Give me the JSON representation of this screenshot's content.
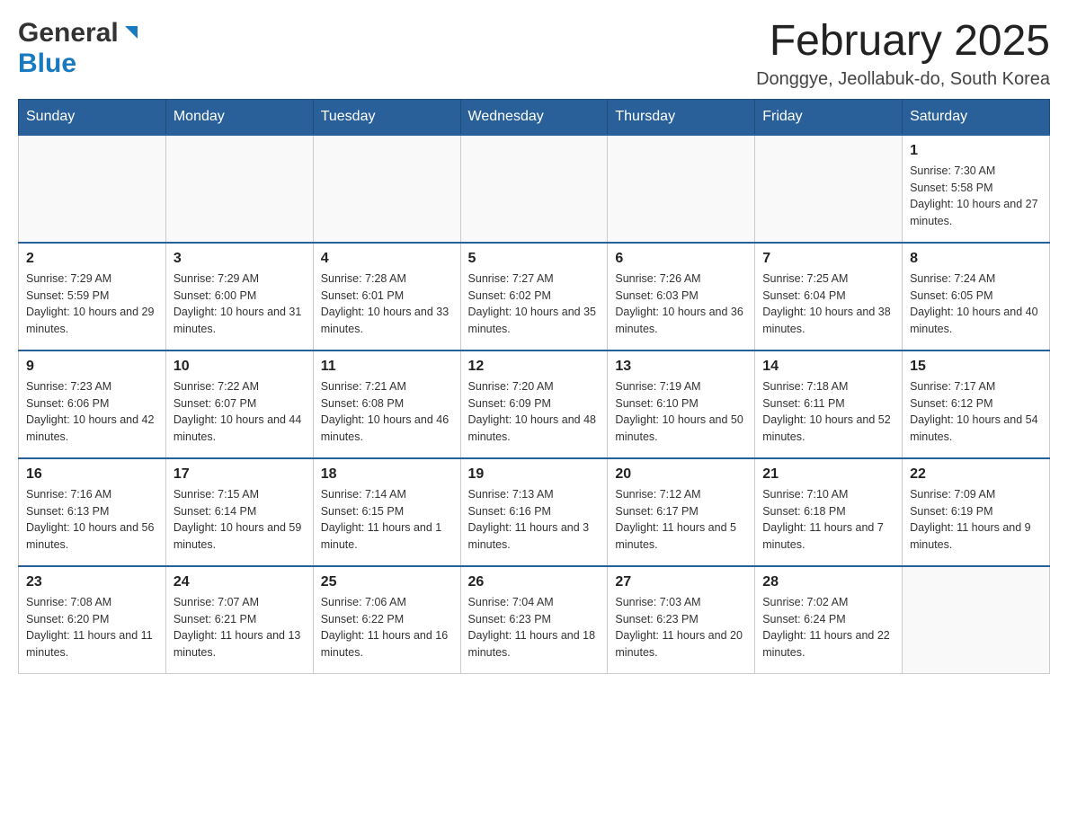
{
  "header": {
    "title": "February 2025",
    "location": "Donggye, Jeollabuk-do, South Korea",
    "logo_general": "General",
    "logo_blue": "Blue"
  },
  "days_of_week": [
    "Sunday",
    "Monday",
    "Tuesday",
    "Wednesday",
    "Thursday",
    "Friday",
    "Saturday"
  ],
  "weeks": [
    [
      {
        "day": "",
        "info": ""
      },
      {
        "day": "",
        "info": ""
      },
      {
        "day": "",
        "info": ""
      },
      {
        "day": "",
        "info": ""
      },
      {
        "day": "",
        "info": ""
      },
      {
        "day": "",
        "info": ""
      },
      {
        "day": "1",
        "info": "Sunrise: 7:30 AM\nSunset: 5:58 PM\nDaylight: 10 hours and 27 minutes."
      }
    ],
    [
      {
        "day": "2",
        "info": "Sunrise: 7:29 AM\nSunset: 5:59 PM\nDaylight: 10 hours and 29 minutes."
      },
      {
        "day": "3",
        "info": "Sunrise: 7:29 AM\nSunset: 6:00 PM\nDaylight: 10 hours and 31 minutes."
      },
      {
        "day": "4",
        "info": "Sunrise: 7:28 AM\nSunset: 6:01 PM\nDaylight: 10 hours and 33 minutes."
      },
      {
        "day": "5",
        "info": "Sunrise: 7:27 AM\nSunset: 6:02 PM\nDaylight: 10 hours and 35 minutes."
      },
      {
        "day": "6",
        "info": "Sunrise: 7:26 AM\nSunset: 6:03 PM\nDaylight: 10 hours and 36 minutes."
      },
      {
        "day": "7",
        "info": "Sunrise: 7:25 AM\nSunset: 6:04 PM\nDaylight: 10 hours and 38 minutes."
      },
      {
        "day": "8",
        "info": "Sunrise: 7:24 AM\nSunset: 6:05 PM\nDaylight: 10 hours and 40 minutes."
      }
    ],
    [
      {
        "day": "9",
        "info": "Sunrise: 7:23 AM\nSunset: 6:06 PM\nDaylight: 10 hours and 42 minutes."
      },
      {
        "day": "10",
        "info": "Sunrise: 7:22 AM\nSunset: 6:07 PM\nDaylight: 10 hours and 44 minutes."
      },
      {
        "day": "11",
        "info": "Sunrise: 7:21 AM\nSunset: 6:08 PM\nDaylight: 10 hours and 46 minutes."
      },
      {
        "day": "12",
        "info": "Sunrise: 7:20 AM\nSunset: 6:09 PM\nDaylight: 10 hours and 48 minutes."
      },
      {
        "day": "13",
        "info": "Sunrise: 7:19 AM\nSunset: 6:10 PM\nDaylight: 10 hours and 50 minutes."
      },
      {
        "day": "14",
        "info": "Sunrise: 7:18 AM\nSunset: 6:11 PM\nDaylight: 10 hours and 52 minutes."
      },
      {
        "day": "15",
        "info": "Sunrise: 7:17 AM\nSunset: 6:12 PM\nDaylight: 10 hours and 54 minutes."
      }
    ],
    [
      {
        "day": "16",
        "info": "Sunrise: 7:16 AM\nSunset: 6:13 PM\nDaylight: 10 hours and 56 minutes."
      },
      {
        "day": "17",
        "info": "Sunrise: 7:15 AM\nSunset: 6:14 PM\nDaylight: 10 hours and 59 minutes."
      },
      {
        "day": "18",
        "info": "Sunrise: 7:14 AM\nSunset: 6:15 PM\nDaylight: 11 hours and 1 minute."
      },
      {
        "day": "19",
        "info": "Sunrise: 7:13 AM\nSunset: 6:16 PM\nDaylight: 11 hours and 3 minutes."
      },
      {
        "day": "20",
        "info": "Sunrise: 7:12 AM\nSunset: 6:17 PM\nDaylight: 11 hours and 5 minutes."
      },
      {
        "day": "21",
        "info": "Sunrise: 7:10 AM\nSunset: 6:18 PM\nDaylight: 11 hours and 7 minutes."
      },
      {
        "day": "22",
        "info": "Sunrise: 7:09 AM\nSunset: 6:19 PM\nDaylight: 11 hours and 9 minutes."
      }
    ],
    [
      {
        "day": "23",
        "info": "Sunrise: 7:08 AM\nSunset: 6:20 PM\nDaylight: 11 hours and 11 minutes."
      },
      {
        "day": "24",
        "info": "Sunrise: 7:07 AM\nSunset: 6:21 PM\nDaylight: 11 hours and 13 minutes."
      },
      {
        "day": "25",
        "info": "Sunrise: 7:06 AM\nSunset: 6:22 PM\nDaylight: 11 hours and 16 minutes."
      },
      {
        "day": "26",
        "info": "Sunrise: 7:04 AM\nSunset: 6:23 PM\nDaylight: 11 hours and 18 minutes."
      },
      {
        "day": "27",
        "info": "Sunrise: 7:03 AM\nSunset: 6:23 PM\nDaylight: 11 hours and 20 minutes."
      },
      {
        "day": "28",
        "info": "Sunrise: 7:02 AM\nSunset: 6:24 PM\nDaylight: 11 hours and 22 minutes."
      },
      {
        "day": "",
        "info": ""
      }
    ]
  ]
}
